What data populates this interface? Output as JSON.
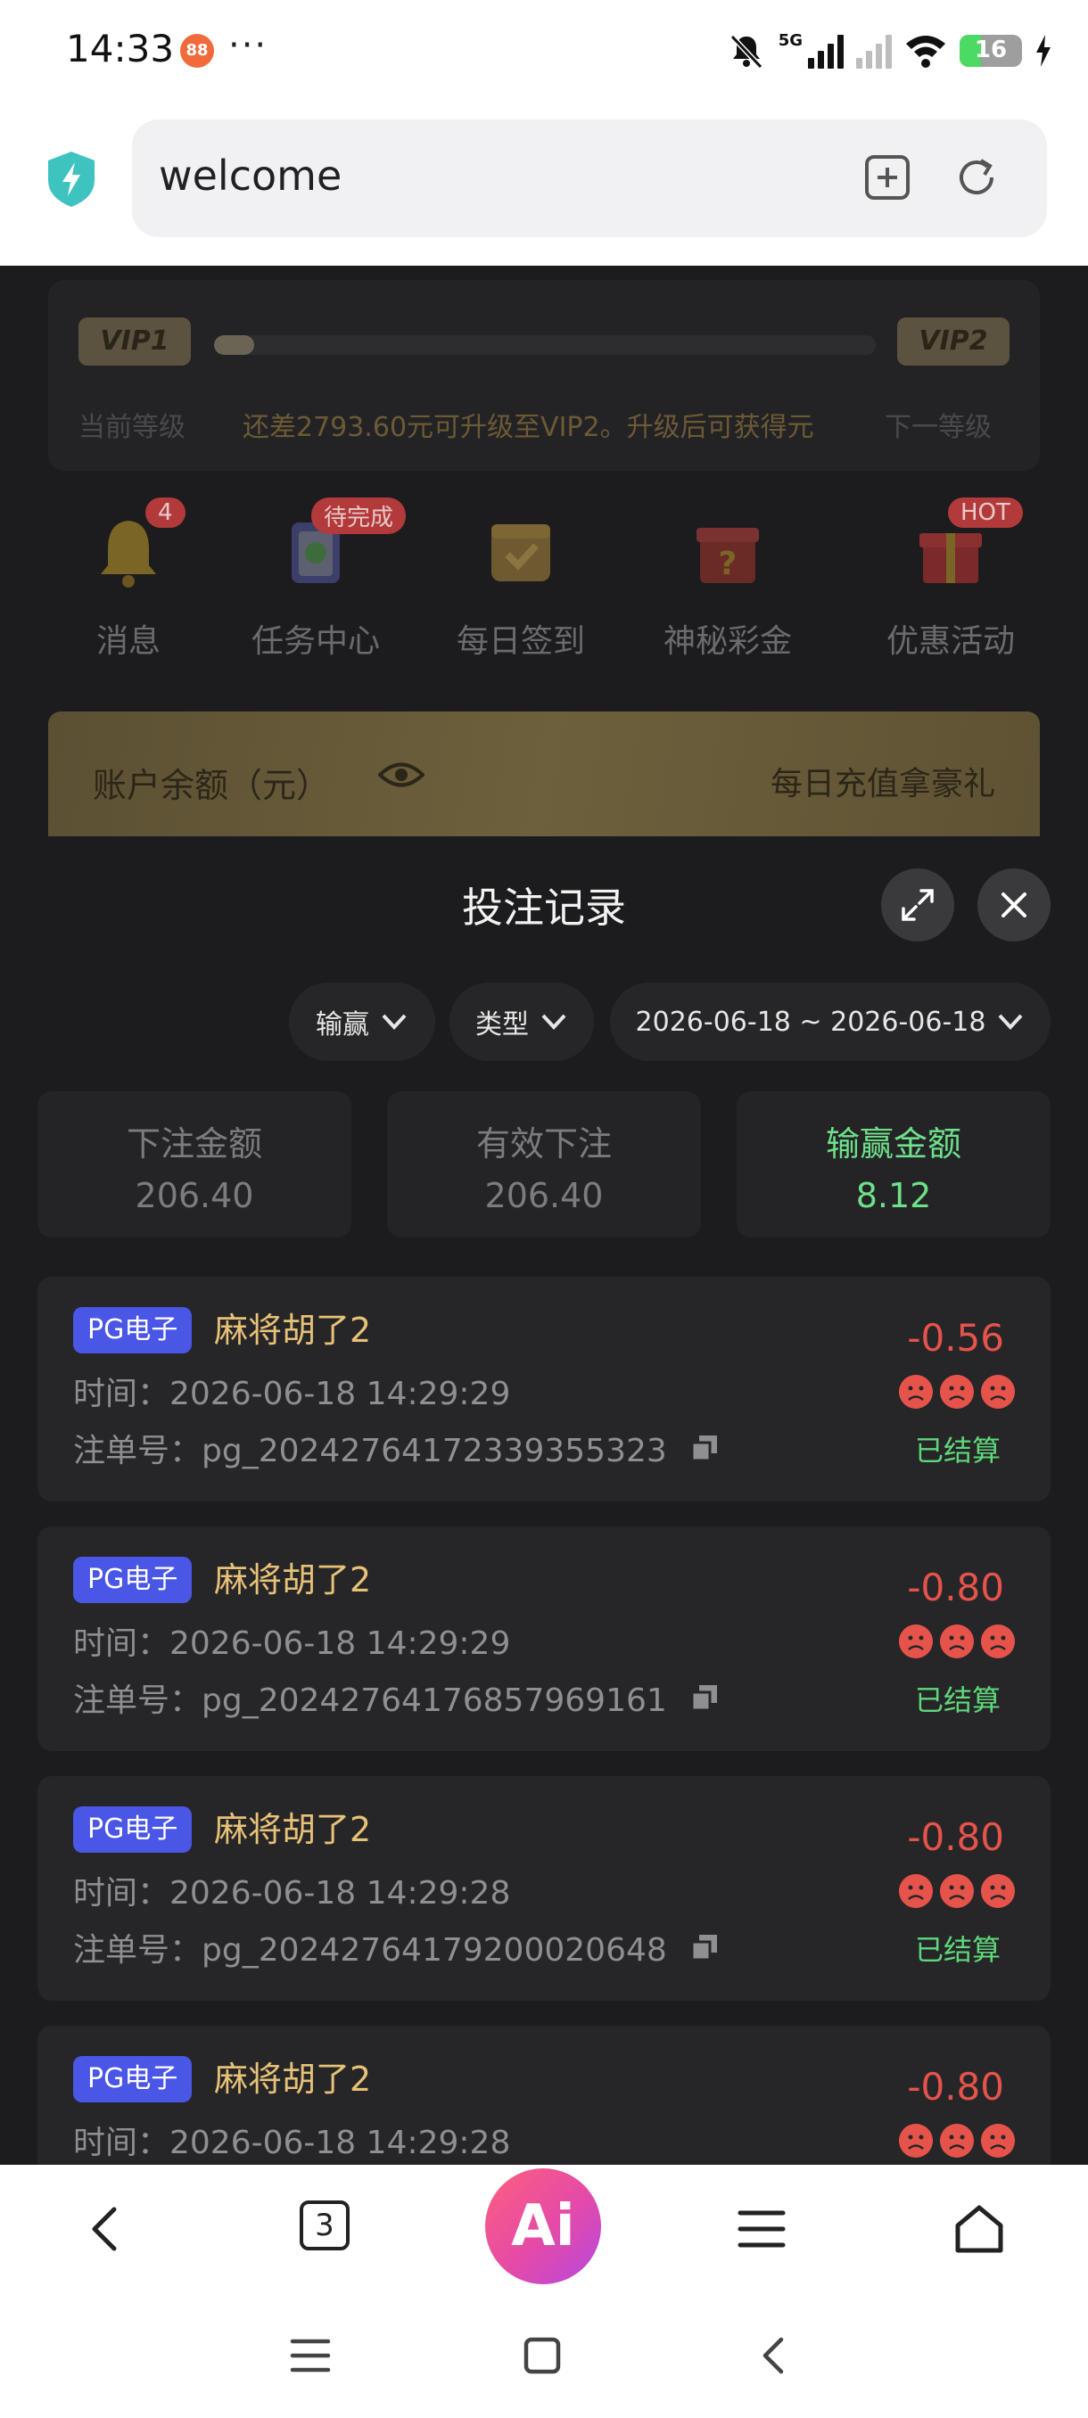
{
  "status_bar": {
    "time": "14:33",
    "app_icon_text": "88",
    "more": "···",
    "network_label": "5G",
    "battery": "16"
  },
  "browser": {
    "url": "welcome"
  },
  "vip": {
    "current_badge": "VIP1",
    "next_badge": "VIP2",
    "progress": 0.04,
    "current_label": "当前等级",
    "upgrade_text": "还差2793.60元可升级至VIP2。升级后可获得元",
    "next_label": "下一等级"
  },
  "quick_icons": [
    {
      "label": "消息",
      "badge": "4",
      "icon": "bell-icon"
    },
    {
      "label": "任务中心",
      "badge": "待完成",
      "icon": "clipboard-icon"
    },
    {
      "label": "每日签到",
      "badge": "",
      "icon": "calendar-check-icon"
    },
    {
      "label": "神秘彩金",
      "badge": "",
      "icon": "mystery-box-icon"
    },
    {
      "label": "优惠活动",
      "badge": "HOT",
      "icon": "gift-icon"
    }
  ],
  "balance": {
    "label": "账户余额（元）",
    "promo": "每日充值拿豪礼"
  },
  "sheet": {
    "title": "投注记录",
    "filters": {
      "winloss": "输赢",
      "type": "类型",
      "date_range": "2026-06-18 ~ 2026-06-18"
    },
    "stats": [
      {
        "label": "下注金额",
        "value": "206.40"
      },
      {
        "label": "有效下注",
        "value": "206.40"
      },
      {
        "label": "输赢金额",
        "value": "8.12"
      }
    ],
    "records": [
      {
        "tag": "PG电子",
        "game": "麻将胡了2",
        "time": "时间：2026-06-18 14:29:29",
        "order": "注单号：pg_2024276417233935532​3",
        "amount": "-0.56",
        "status": "已结算"
      },
      {
        "tag": "PG电子",
        "game": "麻将胡了2",
        "time": "时间：2026-06-18 14:29:29",
        "order": "注单号：pg_20242764176857969161",
        "amount": "-0.80",
        "status": "已结算"
      },
      {
        "tag": "PG电子",
        "game": "麻将胡了2",
        "time": "时间：2026-06-18 14:29:28",
        "order": "注单号：pg_20242764179200020648",
        "amount": "-0.80",
        "status": "已结算"
      },
      {
        "tag": "PG电子",
        "game": "麻将胡了2",
        "time": "时间：2026-06-18 14:29:28",
        "order": "",
        "amount": "-0.80",
        "status": ""
      }
    ]
  },
  "bottom_bar": {
    "tabs_count": "3",
    "ai_label": "Ai"
  },
  "colors": {
    "loss": "#e5534b",
    "settled": "#5fd77a",
    "profit": "#6ee08a",
    "tag": "#4a56e6",
    "game_name": "#e7c177"
  }
}
